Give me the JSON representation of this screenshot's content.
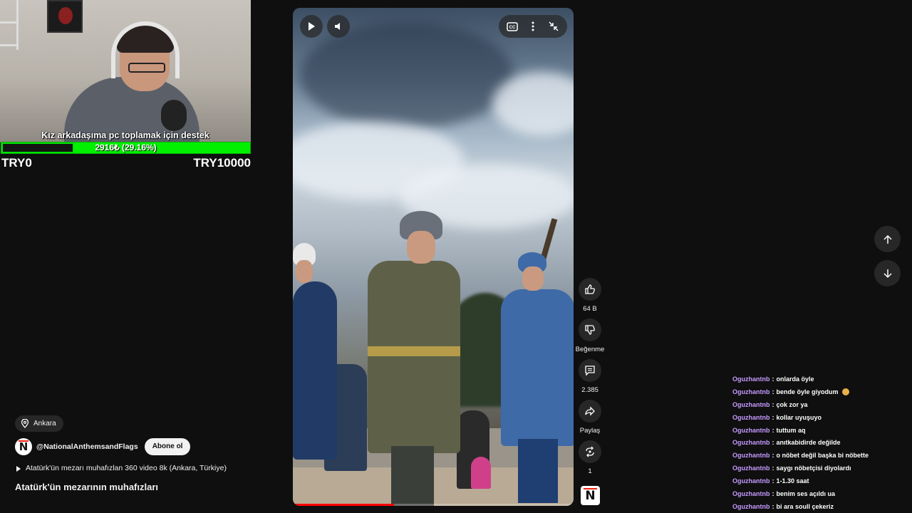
{
  "stream_overlay": {
    "donation_title": "Kız arkadaşıma pc toplamak için destek",
    "goal_progress_text": "2916₺ (29.16%)",
    "goal_progress_fraction": 0.2916,
    "goal_min": "TRY0",
    "goal_max": "TRY10000",
    "goal_color": "#00f000"
  },
  "player": {
    "controls": {
      "play_icon": "play-icon",
      "volume_icon": "volume-icon",
      "captions_icon": "captions-icon",
      "more_icon": "more-vert-icon",
      "collapse_icon": "collapse-icon"
    },
    "progress_fraction": 0.36
  },
  "actions": {
    "like_count": "64 B",
    "dislike_label": "Beğenme",
    "comment_count": "2.385",
    "share_label": "Paylaş",
    "remix_count": "1"
  },
  "meta": {
    "location": "Ankara",
    "channel_handle": "@NationalAnthemsandFlags",
    "subscribe_label": "Abone ol",
    "description": "Atatürk'ün mezarı muhafızlan 360 video 8k (Ankara, Türkiye)",
    "title": "Atatürk'ün mezarının muhafızları",
    "channel_logo_letter": "N"
  },
  "chat": [
    {
      "user": "Oguzhantnb",
      "msg": "onlarda öyle"
    },
    {
      "user": "Oguzhantnb",
      "msg": "bende öyle giyodum",
      "emoji": true
    },
    {
      "user": "Oguzhantnb",
      "msg": "çok zor ya"
    },
    {
      "user": "Oguzhantnb",
      "msg": "kollar uyuşuyo"
    },
    {
      "user": "Oguzhantnb",
      "msg": "tuttum aq"
    },
    {
      "user": "Oguzhantnb",
      "msg": "anıtkabidirde değilde"
    },
    {
      "user": "Oguzhantnb",
      "msg": "o nöbet değil başka bi nöbette"
    },
    {
      "user": "Oguzhantnb",
      "msg": "saygı nöbetçisi diyolardı"
    },
    {
      "user": "Oguzhantnb",
      "msg": "1-1.30 saat"
    },
    {
      "user": "Oguzhantnb",
      "msg": "benim ses açıldı ua"
    },
    {
      "user": "Oguzhantnb",
      "msg": "bi ara soull çekeriz"
    }
  ],
  "colors": {
    "background": "#0f0f0f",
    "chat_username": "#c69aff",
    "progress_red": "#ff0000"
  }
}
